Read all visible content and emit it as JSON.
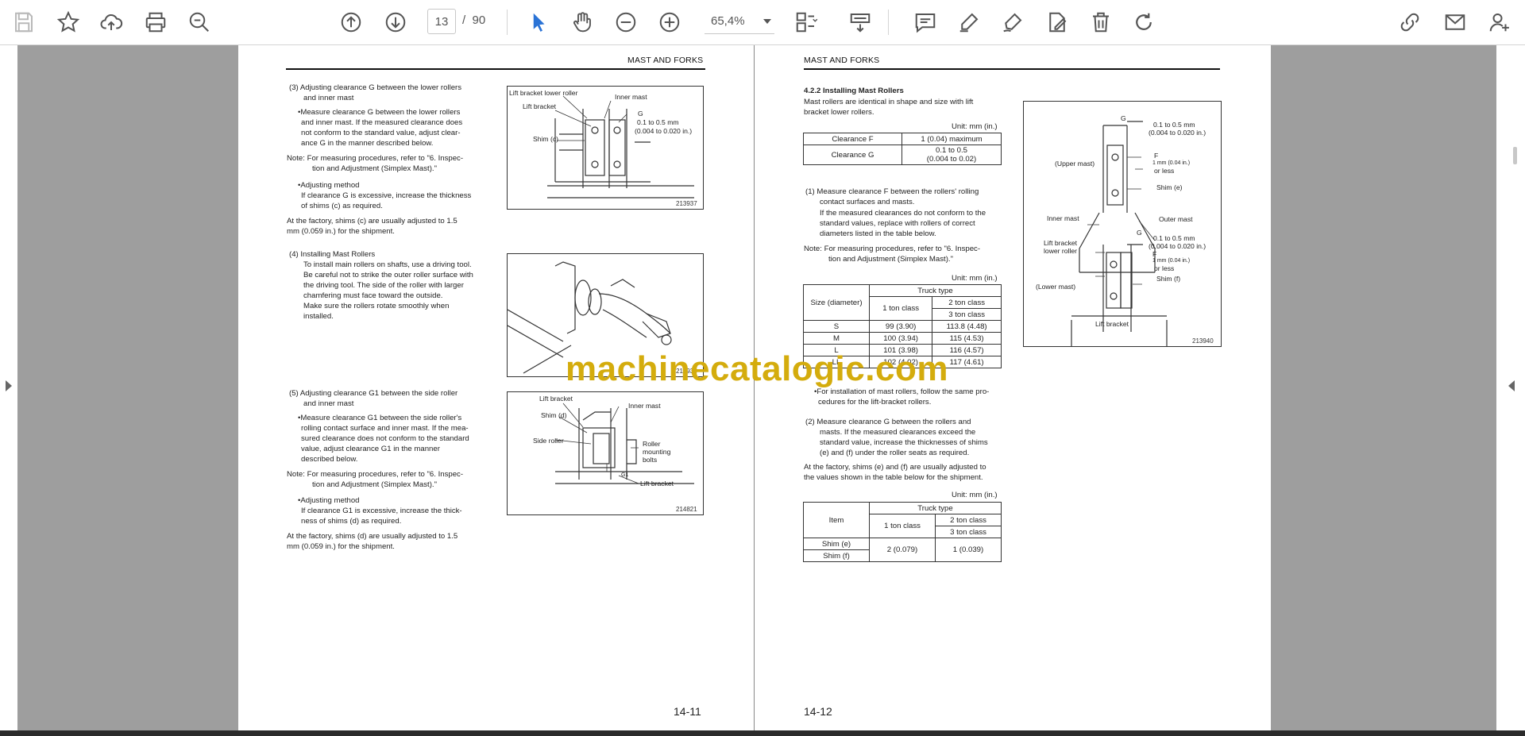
{
  "toolbar": {
    "page_current": "13",
    "page_sep": "/",
    "page_total": "90",
    "zoom": "65,4%"
  },
  "watermark": "machinecatalogic.com",
  "left_page": {
    "header": "MAST AND FORKS",
    "s3_title": "(3)  Adjusting clearance G between the lower rollers",
    "s3_title2": "and inner mast",
    "s3_b1": "•Measure clearance G between the lower rollers",
    "s3_b2": "and inner mast. If the measured clearance does",
    "s3_b3": "not conform to the standard value, adjust clear-",
    "s3_b4": "ance G in the manner described below.",
    "s3_note1": "Note:  For measuring procedures, refer to \"6. Inspec-",
    "s3_note2": "tion and Adjustment (Simplex Mast).\"",
    "s3_adj": "•Adjusting method",
    "s3_adj1": "If clearance G is excessive, increase the thickness",
    "s3_adj2": "of shims (c) as required.",
    "s3_fact1": "At the factory, shims (c) are usually adjusted to 1.5",
    "s3_fact2": "mm  (0.059 in.) for the shipment.",
    "s4_title": "(4)  Installing Mast Rollers",
    "s4_l1": "To install main rollers on shafts, use a driving tool.",
    "s4_l2": "Be careful not to strike the outer roller surface with",
    "s4_l3": "the driving tool. The side of the roller with larger",
    "s4_l4": "chamfering must face toward the outside.",
    "s4_l5": "Make  sure  the  rollers  rotate  smoothly  when",
    "s4_l6": "installed.",
    "s5_title": "(5)  Adjusting clearance G1 between the side roller",
    "s5_title2": "and inner mast",
    "s5_b1": "•Measure clearance G1 between the side roller's",
    "s5_b2": "rolling contact surface and inner mast. If the mea-",
    "s5_b3": "sured clearance does not conform to the standard",
    "s5_b4": "value, adjust clearance G1 in the manner",
    "s5_b5": "described below.",
    "s5_note1": "Note:  For measuring procedures, refer to \"6. Inspec-",
    "s5_note2": "tion and Adjustment (Simplex Mast).\"",
    "s5_adj": "•Adjusting method",
    "s5_adj1": "If clearance G1 is excessive, increase the thick-",
    "s5_adj2": "ness of shims (d) as required.",
    "s5_fact1": "At the factory, shims (d) are usually adjusted to 1.5",
    "s5_fact2": "mm  (0.059 in.) for the shipment.",
    "fig1": {
      "l_lbr": "Lift bracket lower roller",
      "l_inner": "Inner mast",
      "l_lb": "Lift bracket",
      "l_g": "G",
      "l_val1": "0.1 to 0.5 mm",
      "l_val2": "(0.004 to 0.020 in.)",
      "l_shim": "Shim (c)",
      "num": "213937"
    },
    "fig3": {
      "l_lb": "Lift bracket",
      "l_inner": "Inner mast",
      "l_shim": "Shim (d)",
      "l_side": "Side roller",
      "l_rm1": "Roller",
      "l_rm2": "mounting",
      "l_rm3": "bolts",
      "l_g1": "G1",
      "l_lb2": "Lift bracket",
      "num": "214821"
    },
    "page_number": "14-11"
  },
  "right_page": {
    "header": "MAST AND FORKS",
    "sec_title": "4.2.2  Installing Mast Rollers",
    "intro1": "Mast rollers are identical in shape and size with lift",
    "intro2": "bracket lower rollers.",
    "unit": "Unit: mm (in.)",
    "clr_table": {
      "r1c1": "Clearance F",
      "r1c2": "1 (0.04) maximum",
      "r2c1": "Clearance G",
      "r2c2a": "0.1 to 0.5",
      "r2c2b": "(0.004 to 0.02)"
    },
    "s1_l1": "(1)  Measure clearance F between the rollers' rolling",
    "s1_l2": "contact surfaces and masts.",
    "s1_l3": "If the measured clearances do not conform to the",
    "s1_l4": "standard values, replace with rollers of correct",
    "s1_l5": "diameters listed in the table below.",
    "note1": "Note:  For measuring procedures, refer to \"6. Inspec-",
    "note2": "tion and Adjustment (Simplex Mast).\"",
    "size_table": {
      "truck_type": "Truck type",
      "size_hdr": "Size (diameter)",
      "one_ton": "1 ton class",
      "two_ton": "2 ton class",
      "three_ton": "3 ton class",
      "rows": [
        {
          "s": "S",
          "a": "99 (3.90)",
          "b": "113.8 (4.48)"
        },
        {
          "s": "M",
          "a": "100 (3.94)",
          "b": "115 (4.53)"
        },
        {
          "s": "L",
          "a": "101 (3.98)",
          "b": "116 (4.57)"
        },
        {
          "s": "LL",
          "a": "102 (4.02)",
          "b": "117 (4.61)"
        }
      ]
    },
    "b_inst1": "•For installation of mast rollers, follow the same pro-",
    "b_inst2": "cedures for the lift-bracket rollers.",
    "s2_l1": "(2)  Measure  clearance  G  between  the  rollers  and",
    "s2_l2": "masts.  If  the  measured  clearances  exceed  the",
    "s2_l3": "standard value, increase the thicknesses of shims",
    "s2_l4": "(e) and (f) under the roller seats as required.",
    "fact1": "At the factory, shims (e) and (f) are usually adjusted to",
    "fact2": "the values shown in the table below for the shipment.",
    "shim_table": {
      "truck_type": "Truck type",
      "item": "Item",
      "one_ton": "1 ton class",
      "two_ton": "2 ton class",
      "three_ton": "3 ton class",
      "shim_e": "Shim (e)",
      "shim_f": "Shim (f)",
      "v1": "2 (0.079)",
      "v2": "1 (0.039)"
    },
    "fig": {
      "g_top": "G",
      "val1": "0.1 to 0.5 mm",
      "val2": "(0.004 to 0.020 in.)",
      "upper": "(Upper mast)",
      "f1": "F",
      "mm1": "1 mm (0.04 in.)",
      "or1": "or less",
      "shim_e": "Shim (e)",
      "inner": "Inner mast",
      "outer": "Outer mast",
      "g2": "G",
      "val3": "0.1 to 0.5 mm",
      "val4": "(0.004 to 0.020 in.)",
      "lblr1": "Lift bracket",
      "lblr2": "lower roller",
      "f2": "F",
      "mm2": "1 mm (0.04 in.)",
      "or2": "or less",
      "shim_f": "Shim (f)",
      "lower": "(Lower mast)",
      "lift_bracket": "Lift bracket",
      "num": "213940"
    },
    "page_number": "14-12"
  }
}
